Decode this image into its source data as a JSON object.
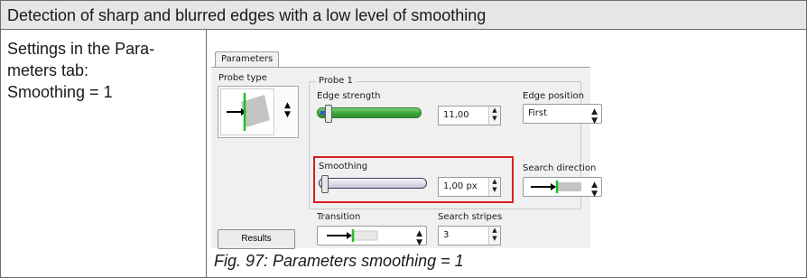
{
  "header": {
    "title": "Detection of sharp and blurred edges with a low level of smoothing"
  },
  "settings": {
    "lines": [
      "Settings in the Para-",
      "meters tab:",
      "Smoothing = 1"
    ]
  },
  "dialog": {
    "tab_label": "Parameters",
    "probe_type_label": "Probe type",
    "probe_group_label": "Probe 1",
    "edge_strength_label": "Edge strength",
    "edge_strength_value": "11,00",
    "edge_strength_level": 0.08,
    "smoothing_label": "Smoothing",
    "smoothing_value": "1,00 px",
    "smoothing_level": 0.02,
    "transition_label": "Transition",
    "search_stripes_label": "Search stripes",
    "search_stripes_value": "3",
    "edge_position_label": "Edge position",
    "edge_position_value": "First",
    "search_direction_label": "Search direction",
    "results_label": "Results",
    "colors": {
      "highlight": "#d62020",
      "edge_slider": "#3aa63a",
      "marker_green": "#1fbf1f"
    },
    "icons": [
      "probe-type-icon",
      "search-direction-icon",
      "transition-icon",
      "spin-arrows-icon"
    ]
  },
  "caption": "Fig. 97: Parameters smoothing = 1"
}
